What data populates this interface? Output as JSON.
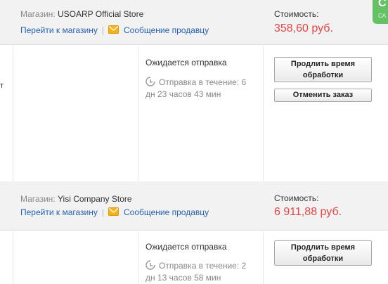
{
  "badge": {
    "top_text": "C",
    "bottom_text": "CA"
  },
  "orders": [
    {
      "store_label": "Магазин:",
      "store_name": "USOARP Official Store",
      "go_to_store": "Перейти к магазину",
      "separator": "|",
      "message_seller": "Сообщение продавцу",
      "cost_label": "Стоимость:",
      "cost_value": "358,60 руб.",
      "row_stub": "т",
      "status": "Ожидается отправка",
      "ship_line1": "Отправка в течение: 6",
      "ship_line2": "дн 23 часов 43 мин",
      "extend_line1": "Продлить время",
      "extend_line2": "обработки",
      "cancel_label": "Отменить заказ"
    },
    {
      "store_label": "Магазин:",
      "store_name": "Yisi Company Store",
      "go_to_store": "Перейти к магазину",
      "separator": "|",
      "message_seller": "Сообщение продавцу",
      "cost_label": "Стоимость:",
      "cost_value": "6 911,88 руб.",
      "status": "Ожидается отправка",
      "ship_line1": "Отправка в течение: 2",
      "ship_line2": "дн 13 часов 58 мин",
      "extend_line1": "Продлить время",
      "extend_line2": "обработки"
    }
  ],
  "colors": {
    "link": "#2761b5",
    "price": "#e64545",
    "badge": "#66c064",
    "header_bg": "#f2f2f2"
  },
  "icons": [
    "envelope-icon",
    "clock-icon"
  ]
}
